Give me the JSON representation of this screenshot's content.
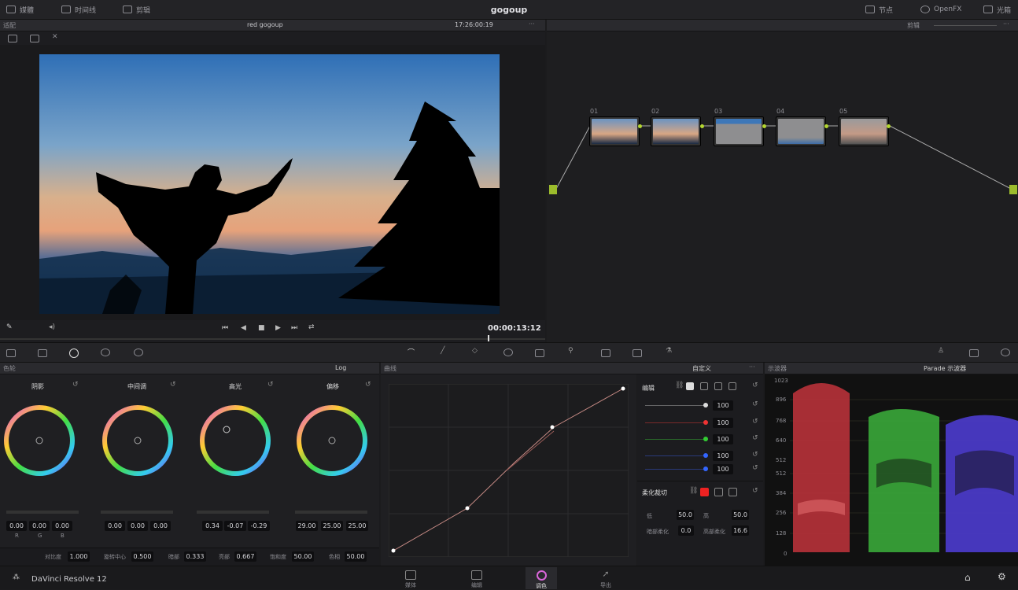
{
  "app": {
    "title": "gogoup",
    "brand": "DaVinci Resolve 12"
  },
  "toolbar": {
    "left": [
      {
        "label": "媒體"
      },
      {
        "label": "时间线"
      },
      {
        "label": "剪辑"
      }
    ],
    "right": [
      {
        "label": "节点"
      },
      {
        "label": "OpenFX"
      },
      {
        "label": "光箱"
      }
    ]
  },
  "viewer": {
    "mode": "适配",
    "clip_name": "red gogoup",
    "timecode_top": "17:26:00:19",
    "timecode": "00:00:13:12"
  },
  "node_editor": {
    "mode": "剪辑",
    "nodes": [
      {
        "label": "01"
      },
      {
        "label": "02"
      },
      {
        "label": "03"
      },
      {
        "label": "04"
      },
      {
        "label": "05"
      }
    ]
  },
  "color_wheels": {
    "header": "色轮",
    "mode": "Log",
    "wheels": [
      {
        "name": "阴影",
        "values": [
          "0.00",
          "0.00",
          "0.00"
        ]
      },
      {
        "name": "中间调",
        "values": [
          "0.00",
          "0.00",
          "0.00"
        ]
      },
      {
        "name": "高光",
        "values": [
          "0.34",
          "-0.07",
          "-0.29"
        ]
      },
      {
        "name": "偏移",
        "values": [
          "29.00",
          "25.00",
          "25.00"
        ]
      }
    ],
    "channel_labels": [
      "R",
      "G",
      "B"
    ],
    "bottom": [
      {
        "label": "对比度",
        "value": "1.000"
      },
      {
        "label": "旋转中心",
        "value": "0.500"
      },
      {
        "label": "暗部",
        "value": "0.333"
      },
      {
        "label": "亮部",
        "value": "0.667"
      },
      {
        "label": "饱和度",
        "value": "50.00"
      },
      {
        "label": "色相",
        "value": "50.00"
      }
    ]
  },
  "curves": {
    "header": "曲线",
    "mode": "自定义",
    "edit_label": "编辑",
    "channels": [
      "100",
      "100",
      "100",
      "100",
      "100"
    ],
    "soft_clip": {
      "label": "柔化裁切",
      "low_label": "低",
      "low": "50.0",
      "high_label": "高",
      "high": "50.0",
      "low_soft_label": "暗部柔化",
      "low_soft": "0.0",
      "high_soft_label": "高部柔化",
      "high_soft": "16.6"
    }
  },
  "scopes": {
    "header": "示波器",
    "mode": "Parade 示波器",
    "scale": [
      "1023",
      "896",
      "768",
      "640",
      "512",
      "512",
      "384",
      "256",
      "128",
      "0"
    ]
  },
  "pages": [
    {
      "label": "媒体"
    },
    {
      "label": "编辑"
    },
    {
      "label": "调色"
    },
    {
      "label": "导出"
    }
  ],
  "colors": {
    "accent": "#b4d630",
    "panel": "#1f1f22",
    "bar": "#252528"
  }
}
